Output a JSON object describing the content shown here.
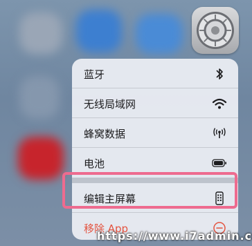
{
  "menu": {
    "items": [
      {
        "label": "蓝牙",
        "icon": "bluetooth-icon"
      },
      {
        "label": "无线局域网",
        "icon": "wifi-icon"
      },
      {
        "label": "蜂窝数据",
        "icon": "cellular-icon"
      },
      {
        "label": "电池",
        "icon": "battery-icon"
      },
      {
        "label": "编辑主屏幕",
        "icon": "phone-screen-icon"
      },
      {
        "label": "移除 App",
        "icon": "minus-circle-icon"
      }
    ]
  },
  "watermark": "https://www.i7admin.cc",
  "colors": {
    "destructive": "#e4533f",
    "highlight": "#ee6b8f"
  }
}
